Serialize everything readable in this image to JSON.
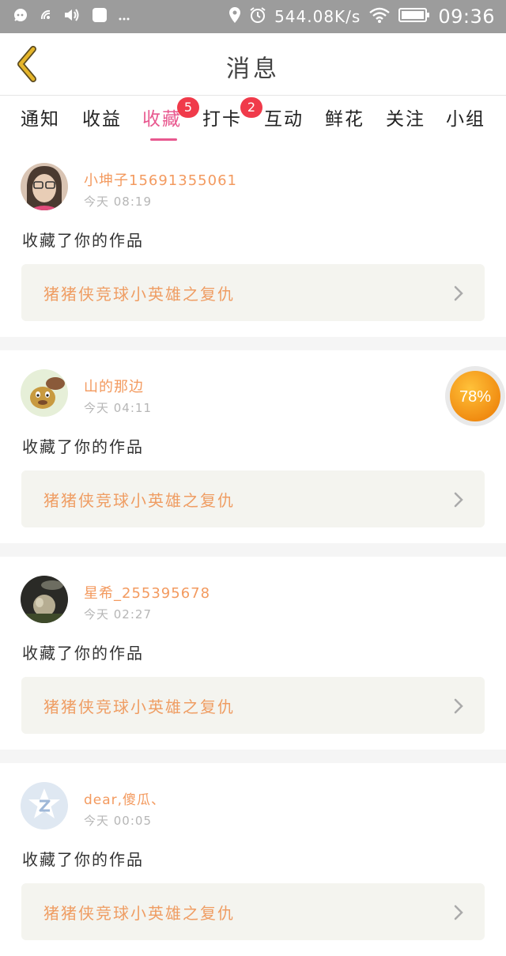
{
  "status_bar": {
    "icons": [
      "notification-icon",
      "nfc-icon",
      "volume-icon",
      "app-icon",
      "more-icon",
      "location-icon",
      "alarm-icon",
      "wifi-icon",
      "battery-icon"
    ],
    "net_speed": "544.08K/s",
    "time": "09:36",
    "background": "#9c9c9c"
  },
  "header": {
    "title": "消息",
    "back_icon": "chevron-left-icon"
  },
  "tabs": [
    {
      "label": "通知"
    },
    {
      "label": "收益"
    },
    {
      "label": "收藏",
      "badge": "5",
      "active": true
    },
    {
      "label": "打卡",
      "badge": "2"
    },
    {
      "label": "互动"
    },
    {
      "label": "鲜花"
    },
    {
      "label": "关注"
    },
    {
      "label": "小组"
    }
  ],
  "messages": [
    {
      "user": "小坤子15691355061",
      "time": "今天  08:19",
      "action": "收藏了你的作品",
      "work": "猪猪侠竞球小英雄之复仇"
    },
    {
      "user": "山的那边",
      "time": "今天  04:11",
      "action": "收藏了你的作品",
      "work": "猪猪侠竞球小英雄之复仇"
    },
    {
      "user": "星希_255395678",
      "time": "今天  02:27",
      "action": "收藏了你的作品",
      "work": "猪猪侠竞球小英雄之复仇"
    },
    {
      "user": "dear,傻瓜、",
      "time": "今天  00:05",
      "action": "收藏了你的作品",
      "work": "猪猪侠竞球小英雄之复仇"
    }
  ],
  "floating_progress": {
    "value": 78,
    "label": "78%"
  },
  "colors": {
    "accent": "#e8588f",
    "badge": "#f03a4a",
    "username": "#f39a5f",
    "work_title": "#ef9d63",
    "back_arrow": "#e5b52a"
  }
}
